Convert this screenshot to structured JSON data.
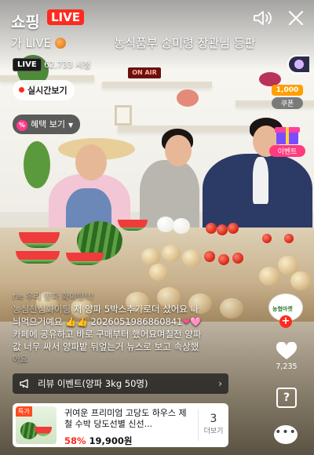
{
  "header": {
    "brand": "쇼핑",
    "live_tag": "LIVE",
    "title_left": "가 LIVE",
    "title_right": "농식품부 송미령 장관님 등판"
  },
  "stream": {
    "live_badge": "LIVE",
    "viewers": "62,733 시청",
    "studio_sign": "ON AIR"
  },
  "buttons": {
    "realtime": "실시간보기",
    "benefit": "혜택 보기",
    "benefit_icon": "%",
    "review_event": "리뷰 이벤트(양파 3kg 50명)"
  },
  "side": {
    "coupon_amount": "1,000",
    "coupon_label": "쿠폰",
    "event_label": "이벤트",
    "shop_name": "농협마켓",
    "like_count": "7,235"
  },
  "chat": {
    "faded_line": "rie 우리 양파 화이팅!!!",
    "line1_user": "농심천심화이팅",
    "line1_text": "저 양파 5박스추가로더 샀어요 나",
    "line2_text": "늬먹으거예요 👍👍",
    "line2_id": "2026051986860841",
    "line3_text": "카페에 공유하고 바로 구매부터 했어요며칠전 양파",
    "line4_text": "값 너무 싸서 양파밭 뒤엎는거 뉴스로 보고 속상했",
    "line5_text": "어요"
  },
  "product": {
    "tag": "특가",
    "name": "귀여운 프리미엄 고당도 하우스 제철 수박 당도선별 신선...",
    "discount": "58%",
    "price": "19,900원",
    "more_count": "3",
    "more_label": "더보기"
  },
  "colors": {
    "live_red": "#ff2a1f",
    "coupon_orange": "#ff9f00",
    "event_pink": "#ff3b7f",
    "discount_red": "#ff2a1f"
  },
  "icons": {
    "volume": "speaker-icon",
    "close": "close-icon",
    "like": "heart-icon",
    "help": "question-icon",
    "chat": "chat-bubble-icon",
    "review": "megaphone-icon"
  }
}
